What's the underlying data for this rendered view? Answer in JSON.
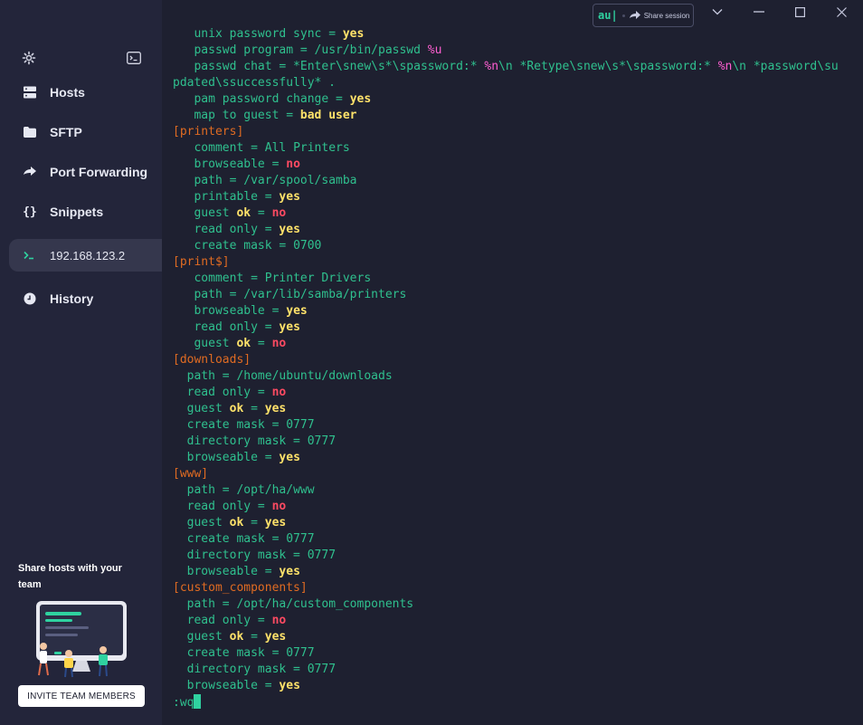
{
  "sidebar": {
    "nav": [
      {
        "label": "Hosts",
        "icon": "hosts-icon"
      },
      {
        "label": "SFTP",
        "icon": "folder-icon"
      },
      {
        "label": "Port Forwarding",
        "icon": "port-forward-icon"
      },
      {
        "label": "Snippets",
        "icon": "snippets-icon"
      },
      {
        "label": "192.168.123.2",
        "icon": "terminal-icon",
        "active": true
      },
      {
        "label": "History",
        "icon": "history-icon"
      }
    ],
    "promo": {
      "title": "Share hosts with your team",
      "button": "INVITE TEAM MEMBERS"
    }
  },
  "topbar": {
    "session_initials": "au|",
    "share_label": "Share session"
  },
  "terminal": {
    "lines": [
      {
        "indent": "   ",
        "key": "unix password sync",
        "val": "yes",
        "vt": "y"
      },
      {
        "indent": "   ",
        "key": "passwd program",
        "val": "/usr/bin/passwd ",
        "vt": "v",
        "extra": "%u",
        "et": "p"
      },
      {
        "indent": "   ",
        "raw": "passwd chat = *Enter\\snew\\s*\\spassword:* %n\\n *Retype\\snew\\s*\\spassword:* %n\\n *password\\su"
      },
      {
        "indent": "",
        "raw2": "pdated\\ssuccessfully* ."
      },
      {
        "indent": "   ",
        "key": "pam password change",
        "val": "yes",
        "vt": "y"
      },
      {
        "indent": "   ",
        "key": "map to guest",
        "val": "bad user",
        "vt": "y"
      },
      {
        "section": "[printers]"
      },
      {
        "indent": "   ",
        "key": "comment",
        "val": "All Printers",
        "vt": "v"
      },
      {
        "indent": "   ",
        "key": "browseable",
        "val": "no",
        "vt": "n"
      },
      {
        "indent": "   ",
        "key": "path",
        "val": "/var/spool/samba",
        "vt": "v"
      },
      {
        "indent": "   ",
        "key": "printable",
        "val": "yes",
        "vt": "y"
      },
      {
        "indent": "   ",
        "key": "guest ok",
        "val": "no",
        "vt": "n"
      },
      {
        "indent": "   ",
        "key": "read only",
        "val": "yes",
        "vt": "y"
      },
      {
        "indent": "   ",
        "key": "create mask",
        "val": "0700",
        "vt": "v"
      },
      {
        "section": "[print$]"
      },
      {
        "indent": "   ",
        "key": "comment",
        "val": "Printer Drivers",
        "vt": "v"
      },
      {
        "indent": "   ",
        "key": "path",
        "val": "/var/lib/samba/printers",
        "vt": "v"
      },
      {
        "indent": "   ",
        "key": "browseable",
        "val": "yes",
        "vt": "y"
      },
      {
        "indent": "   ",
        "key": "read only",
        "val": "yes",
        "vt": "y"
      },
      {
        "indent": "   ",
        "key": "guest ok",
        "val": "no",
        "vt": "n"
      },
      {
        "section": "[downloads]"
      },
      {
        "indent": "  ",
        "key": "path",
        "val": "/home/ubuntu/downloads",
        "vt": "v"
      },
      {
        "indent": "  ",
        "key": "read only",
        "val": "no",
        "vt": "n"
      },
      {
        "indent": "  ",
        "key": "guest ok",
        "val": "yes",
        "vt": "y"
      },
      {
        "indent": "  ",
        "key": "create mask",
        "val": "0777",
        "vt": "v"
      },
      {
        "indent": "  ",
        "key": "directory mask",
        "val": "0777",
        "vt": "v"
      },
      {
        "indent": "  ",
        "key": "browseable",
        "val": "yes",
        "vt": "y"
      },
      {
        "section": "[www]"
      },
      {
        "indent": "  ",
        "key": "path",
        "val": "/opt/ha/www",
        "vt": "v"
      },
      {
        "indent": "  ",
        "key": "read only",
        "val": "no",
        "vt": "n"
      },
      {
        "indent": "  ",
        "key": "guest ok",
        "val": "yes",
        "vt": "y"
      },
      {
        "indent": "  ",
        "key": "create mask",
        "val": "0777",
        "vt": "v"
      },
      {
        "indent": "  ",
        "key": "directory mask",
        "val": "0777",
        "vt": "v"
      },
      {
        "indent": "  ",
        "key": "browseable",
        "val": "yes",
        "vt": "y"
      },
      {
        "section": "[custom_components]"
      },
      {
        "indent": "  ",
        "key": "path",
        "val": "/opt/ha/custom_components",
        "vt": "v"
      },
      {
        "indent": "  ",
        "key": "read only",
        "val": "no",
        "vt": "n"
      },
      {
        "indent": "  ",
        "key": "guest ok",
        "val": "yes",
        "vt": "y"
      },
      {
        "indent": "  ",
        "key": "create mask",
        "val": "0777",
        "vt": "v"
      },
      {
        "indent": "  ",
        "key": "directory mask",
        "val": "0777",
        "vt": "v"
      },
      {
        "indent": "  ",
        "key": "browseable",
        "val": "yes",
        "vt": "y"
      }
    ],
    "command": ":wq"
  },
  "colors": {
    "accent": "#2fd2a0",
    "section": "#e06b22",
    "yes": "#ffe26a",
    "no": "#ff4a62",
    "escape": "#ff5fd2"
  }
}
